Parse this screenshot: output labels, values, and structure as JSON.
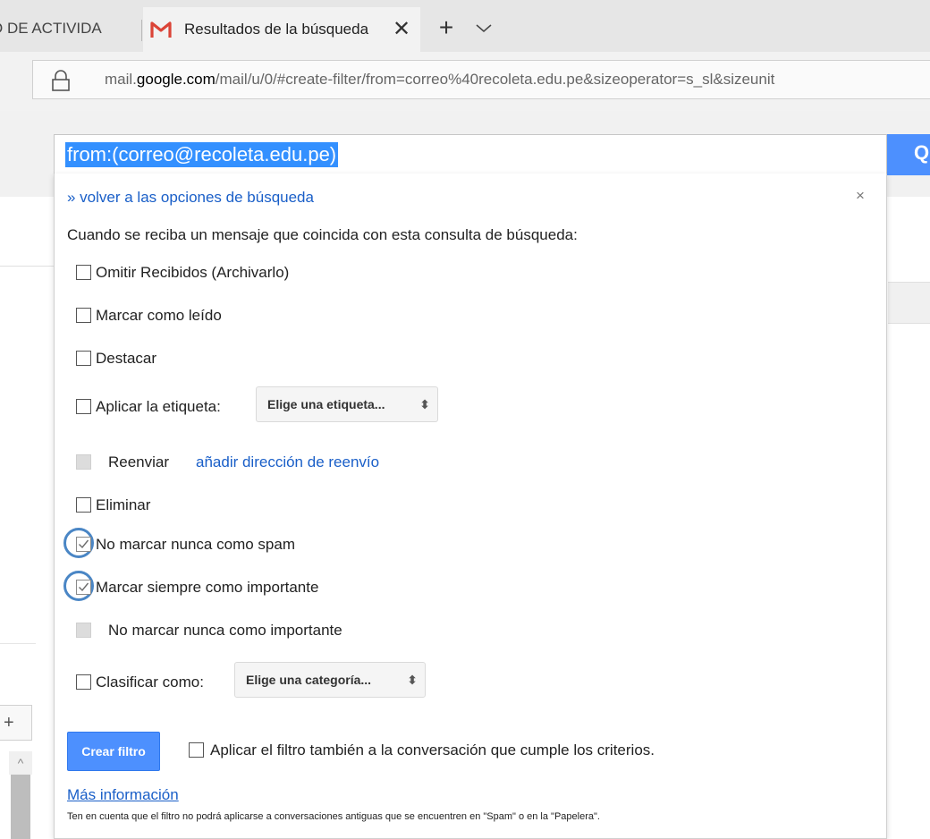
{
  "browser": {
    "inactive_tab_title": "O DE ACTIVIDA",
    "active_tab_title": "Resultados de la búsqueda",
    "close_glyph": "✕",
    "new_tab_glyph": "+",
    "url_prefix": "mail.",
    "url_domain": "google.com",
    "url_path": "/mail/u/0/#create-filter/from=correo%40recoleta.edu.pe&sizeoperator=s_sl&sizeunit"
  },
  "search": {
    "query": "from:(correo@recoleta.edu.pe)",
    "button_glyph": "Q"
  },
  "background": {
    "plus_glyph": "+",
    "scroll_up_glyph": "^"
  },
  "filter": {
    "back_link": "» volver a las opciones de búsqueda",
    "close_glyph": "×",
    "intro": "Cuando se reciba un mensaje que coincida con esta consulta de búsqueda:",
    "options": [
      {
        "label": "Omitir Recibidos (Archivarlo)",
        "checked": false,
        "disabled": false
      },
      {
        "label": "Marcar como leído",
        "checked": false,
        "disabled": false
      },
      {
        "label": "Destacar",
        "checked": false,
        "disabled": false
      },
      {
        "label": "Aplicar la etiqueta:",
        "checked": false,
        "disabled": false
      },
      {
        "label": "Reenviar",
        "checked": false,
        "disabled": true
      },
      {
        "label": "Eliminar",
        "checked": false,
        "disabled": false
      },
      {
        "label": "No marcar nunca como spam",
        "checked": true,
        "disabled": false
      },
      {
        "label": "Marcar siempre como importante",
        "checked": true,
        "disabled": false
      },
      {
        "label": "No marcar nunca como importante",
        "checked": false,
        "disabled": true
      },
      {
        "label": "Clasificar como:",
        "checked": false,
        "disabled": false
      }
    ],
    "label_select": "Elige una etiqueta...",
    "category_select": "Elige una categoría...",
    "select_arrows": "⬍",
    "forward_link": "añadir dirección de reenvío",
    "create_button": "Crear filtro",
    "apply_also": "Aplicar el filtro también a la conversación que cumple los criterios.",
    "more_info": "Más información",
    "note": "Ten en cuenta que el filtro no podrá aplicarse a conversaciones antiguas que se encuentren en \"Spam\" o en la \"Papelera\"."
  },
  "colors": {
    "accent": "#4d90fe",
    "link": "#1a5fc8",
    "highlight_ring": "#4a86c5"
  }
}
